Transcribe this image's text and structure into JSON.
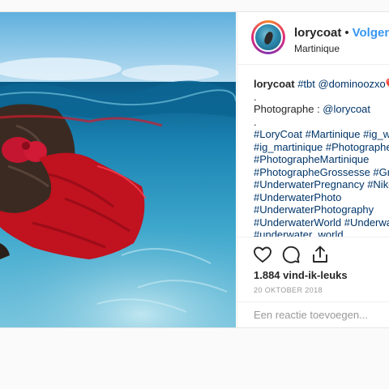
{
  "post": {
    "username": "lorycoat",
    "separator": "•",
    "follow_label": "Volgen",
    "location": "Martinique"
  },
  "caption": {
    "line1_user": "lorycoat",
    "line1_text": " #tbt @dominoozxo❤️",
    "line2": ".",
    "line3_prefix": "Photographe : ",
    "line3_mention": "@lorycoat",
    "line4": ".",
    "tag_lines": [
      "#LoryCoat #Martinique #ig_w",
      "#ig_martinique #Photographe",
      "#PhotographeMartinique",
      "#PhotographeGrossesse #Gro",
      "#UnderwaterPregnancy #Niko",
      "#UnderwaterPhoto",
      "#UnderwaterPhotography",
      "#UnderwaterWorld #Underwa",
      "#underwater_world"
    ]
  },
  "actions": {
    "like_icon": "heart-icon",
    "comment_icon": "comment-icon",
    "share_icon": "share-icon"
  },
  "likes": "1.884 vind-ik-leuks",
  "date": "20 OKTOBER 2018",
  "comment": {
    "placeholder": "Een reactie toevoegen...",
    "value": ""
  },
  "colors": {
    "link": "#003569",
    "follow": "#3897f0",
    "water": "#1f86b4",
    "fabric": "#c0121f"
  }
}
